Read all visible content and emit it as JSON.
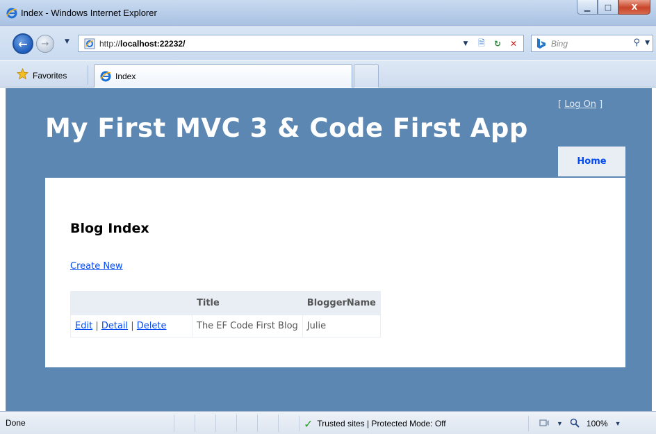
{
  "window": {
    "title": "Index - Windows Internet Explorer",
    "minimize_glyph": "▁",
    "maximize_glyph": "□",
    "close_glyph": "X"
  },
  "nav": {
    "back_glyph": "←",
    "forward_glyph": "→",
    "dropdown_glyph": "▼",
    "address_prefix": "http://",
    "address_host": "localhost:22232/",
    "tools": {
      "dropdown": "▼",
      "compat": "🗎",
      "refresh": "↻",
      "stop": "✕"
    },
    "search": {
      "placeholder": "Bing",
      "button_glyph": "⚲",
      "dropdown": "▼"
    }
  },
  "favbar": {
    "favorites_label": "Favorites",
    "tab_label": "Index"
  },
  "site": {
    "login_open": "[ ",
    "login_link": "Log On",
    "login_close": " ]",
    "title": "My First MVC 3 & Code First App",
    "menu_home": "Home"
  },
  "content": {
    "heading": "Blog Index",
    "create_link": "Create New",
    "table": {
      "headers": [
        "",
        "Title",
        "BloggerName"
      ],
      "rows": [
        {
          "actions": {
            "edit": "Edit",
            "detail": "Detail",
            "delete": "Delete",
            "separator": " | "
          },
          "title": "The EF Code First Blog",
          "blogger": "Julie"
        }
      ]
    }
  },
  "status": {
    "left": "Done",
    "zone": "Trusted sites | Protected Mode: Off",
    "zoom": "100%",
    "dropdown": "▼"
  },
  "colors": {
    "page_background": "#5c87b2",
    "link": "#034af3",
    "menu_background": "#e8eef4"
  }
}
